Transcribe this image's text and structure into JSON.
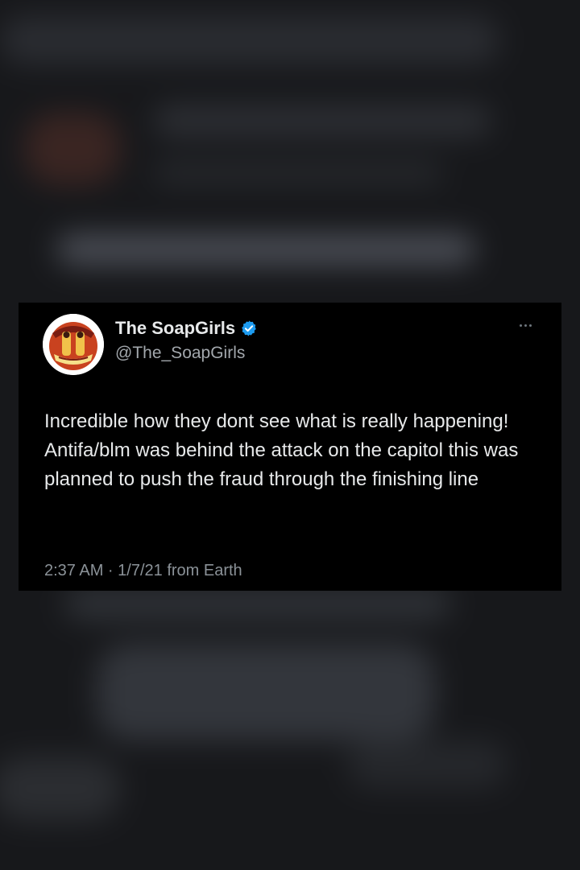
{
  "tweet": {
    "display_name": "The SoapGirls",
    "handle": "@The_SoapGirls",
    "verified": true,
    "text": "Incredible how they dont see what is really happening! Antifa/blm was behind the attack on the capitol this was planned to push the fraud through the finishing line",
    "timestamp": "2:37 AM · 1/7/21 from Earth"
  },
  "icons": {
    "verified": "verified-badge-icon",
    "more": "more-options-icon"
  },
  "colors": {
    "card_background": "#000000",
    "verified_blue": "#1d9bf0",
    "primary_text": "#e7e9ea",
    "secondary_text": "#8b9298"
  }
}
